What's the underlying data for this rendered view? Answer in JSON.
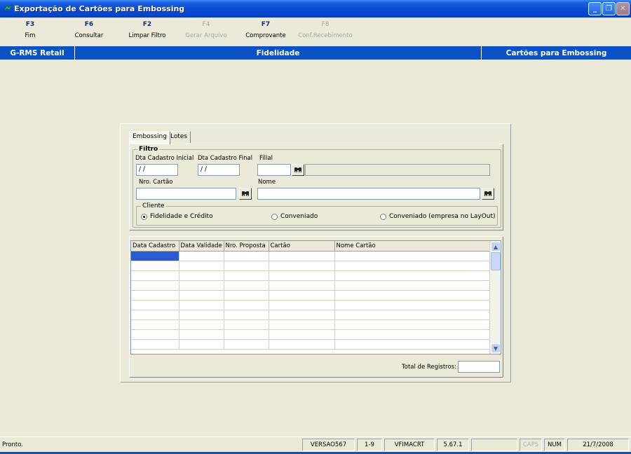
{
  "window": {
    "title": "Exportação de Cartões para Embossing"
  },
  "toolbar": {
    "buttons": [
      {
        "key": "F3",
        "label": "Fim",
        "enabled": true
      },
      {
        "key": "F6",
        "label": "Consultar",
        "enabled": true
      },
      {
        "key": "F2",
        "label": "Limpar Filtro",
        "enabled": true
      },
      {
        "key": "F4",
        "label": "Gerar Arquivo",
        "enabled": false
      },
      {
        "key": "F7",
        "label": "Comprovante",
        "enabled": true
      },
      {
        "key": "F8",
        "label": "Conf.Recebimento",
        "enabled": false
      }
    ]
  },
  "header": {
    "left": "G-RMS Retail",
    "center": "Fidelidade",
    "right": "Cartões para Embossing"
  },
  "tabs": [
    "Embossing",
    "Lotes"
  ],
  "filter": {
    "title": "Filtro",
    "dta_inicial_label": "Dta Cadastro Inicial",
    "dta_inicial_value": " / /",
    "dta_final_label": "Dta Cadastro Final",
    "dta_final_value": " / /",
    "filial_label": "Filial",
    "filial_value": "",
    "nro_cartao_label": "Nro. Cartão",
    "nro_cartao_value": "",
    "nome_label": "Nome",
    "nome_value": ""
  },
  "cliente": {
    "title": "Cliente",
    "options": [
      {
        "label": "Fidelidade e Crédito",
        "selected": true
      },
      {
        "label": "Conveniado",
        "selected": false
      },
      {
        "label": "Conveniado (empresa no LayOut)",
        "selected": false
      }
    ]
  },
  "grid": {
    "columns": [
      "Data Cadastro",
      "Data Validade",
      "Nro. Proposta",
      "Cartão",
      "Nome Cartão"
    ],
    "rows": 10
  },
  "total": {
    "label": "Total de Registros:",
    "value": ""
  },
  "statusbar": {
    "message": "Pronto.",
    "panels": [
      "VERSAO567",
      "1-9",
      "VFIMACRT",
      "5.67.1",
      "",
      "CAPS",
      "NUM",
      "21/7/2008"
    ]
  },
  "icons": {
    "binoculars": "binoculars-icon",
    "app": "app-icon"
  }
}
